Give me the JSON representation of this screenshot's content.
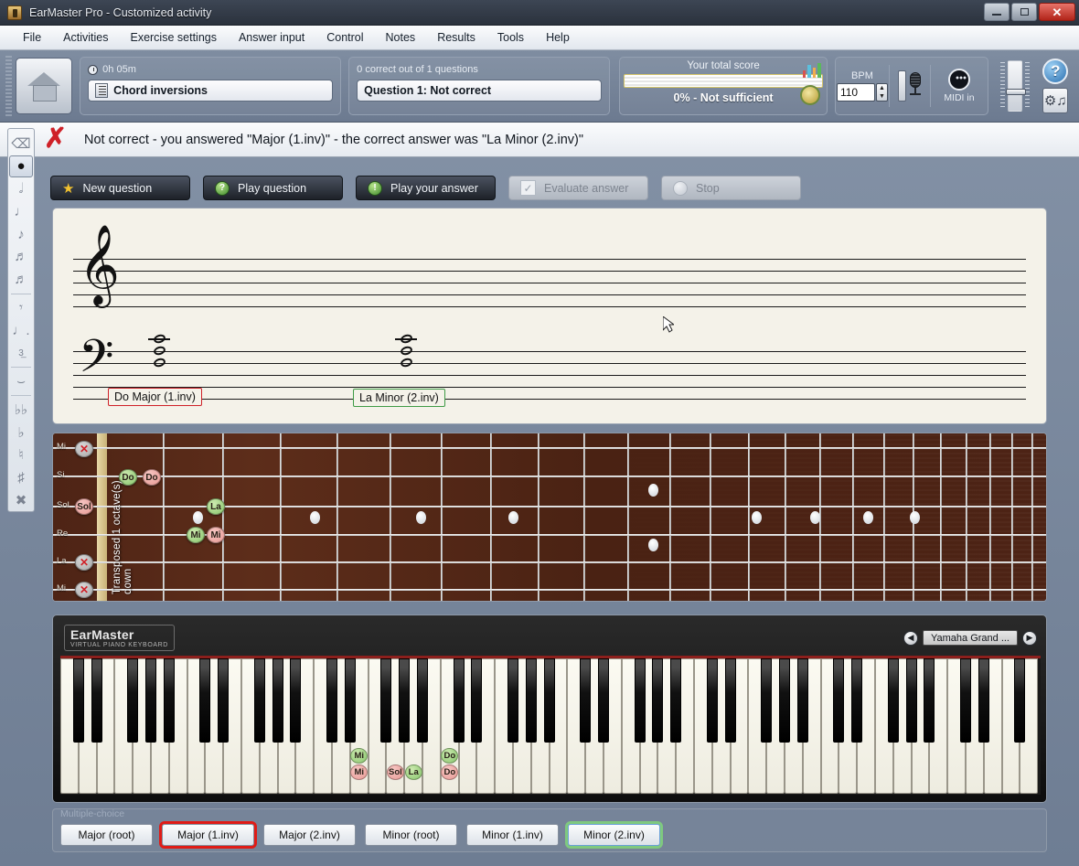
{
  "window": {
    "title": "EarMaster Pro - Customized activity",
    "app_icon": "earmaster-icon",
    "minimize": "–",
    "maximize": "❐",
    "close": "✕"
  },
  "menu": {
    "items": [
      "File",
      "Activities",
      "Exercise settings",
      "Answer input",
      "Control",
      "Notes",
      "Results",
      "Tools",
      "Help"
    ]
  },
  "toolbar": {
    "home_icon": "home-icon",
    "time_label": "0h 05m",
    "activity_name": "Chord inversions",
    "progress_label": "0 correct out of 1 questions",
    "question_status": "Question 1: Not correct",
    "score_title": "Your total score",
    "score_value": "0% - Not sufficient",
    "score_percent": 0,
    "bpm_label": "BPM",
    "bpm_value": "110",
    "midi_label": "MIDI in",
    "help_glyph": "?",
    "settings_icon": "settings-notes-icon",
    "stats_icon": "statistics-icon",
    "medal_icon": "medal-icon"
  },
  "message": {
    "icon": "error-x-icon",
    "text": "Not correct - you answered \"Major (1.inv)\" - the correct answer was \"La Minor (2.inv)\""
  },
  "left_toolbar": {
    "items": [
      {
        "name": "eraser-icon",
        "glyph": "⌫"
      },
      {
        "name": "whole-note-icon",
        "glyph": "𝄽",
        "selected": true
      },
      {
        "name": "half-note-icon",
        "glyph": "𝅗𝅥"
      },
      {
        "name": "quarter-note-icon",
        "glyph": "♩"
      },
      {
        "name": "eighth-note-icon",
        "glyph": "♪"
      },
      {
        "name": "sixteenth-note-icon",
        "glyph": "♫"
      },
      {
        "name": "thirtysecond-note-icon",
        "glyph": "♬"
      },
      {
        "name": "rest-icon",
        "glyph": "𝄽"
      },
      {
        "name": "dotted-note-icon",
        "glyph": "♩."
      },
      {
        "name": "triplet-icon",
        "glyph": "3"
      },
      {
        "name": "tie-icon",
        "glyph": "⌣"
      },
      {
        "name": "double-flat-icon",
        "glyph": "𝄫"
      },
      {
        "name": "flat-icon",
        "glyph": "♭"
      },
      {
        "name": "natural-icon",
        "glyph": "♮"
      },
      {
        "name": "sharp-icon",
        "glyph": "♯"
      },
      {
        "name": "double-sharp-icon",
        "glyph": "𝄪"
      }
    ]
  },
  "actions": [
    {
      "name": "new-question-button",
      "label": "New question",
      "icon": "star-icon",
      "state": "enabled"
    },
    {
      "name": "play-question-button",
      "label": "Play question",
      "icon": "play-question-icon",
      "state": "enabled"
    },
    {
      "name": "play-your-answer-button",
      "label": "Play your answer",
      "icon": "play-answer-icon",
      "state": "enabled"
    },
    {
      "name": "evaluate-answer-button",
      "label": "Evaluate answer",
      "icon": "check-icon",
      "state": "disabled"
    },
    {
      "name": "stop-button",
      "label": "Stop",
      "icon": "stop-icon",
      "state": "disabled"
    }
  ],
  "staff": {
    "treble_clef": "𝄞",
    "bass_clef": "𝄢",
    "chords": [
      {
        "label": "Do Major (1.inv)",
        "status": "wrong"
      },
      {
        "label": "La Minor (2.inv)",
        "status": "correct"
      }
    ]
  },
  "fretboard": {
    "transposed_note": "Transposed 1 octave(s) down",
    "string_labels": [
      "Mi",
      "Si",
      "Sol",
      "Re",
      "La",
      "Mi"
    ],
    "markers": [
      {
        "string": "Mi",
        "label": "✕",
        "color": "grey"
      },
      {
        "string": "Si",
        "label": "Do",
        "color": "green"
      },
      {
        "string": "Si",
        "label": "Do",
        "color": "red"
      },
      {
        "string": "Sol",
        "label": "Sol",
        "color": "red"
      },
      {
        "string": "Sol",
        "label": "La",
        "color": "green"
      },
      {
        "string": "Re",
        "label": "Mi",
        "color": "green"
      },
      {
        "string": "Re",
        "label": "Mi",
        "color": "red"
      },
      {
        "string": "La",
        "label": "✕",
        "color": "grey"
      },
      {
        "string": "Mi",
        "label": "✕",
        "color": "grey"
      }
    ]
  },
  "piano": {
    "logo_title": "EarMaster",
    "logo_subtitle": "VIRTUAL PIANO KEYBOARD",
    "instrument": "Yamaha Grand ...",
    "prev_glyph": "◀",
    "next_glyph": "▶",
    "markers": [
      {
        "label": "Mi",
        "color": "green"
      },
      {
        "label": "Mi",
        "color": "red"
      },
      {
        "label": "Sol",
        "color": "red"
      },
      {
        "label": "La",
        "color": "green"
      },
      {
        "label": "Do",
        "color": "green"
      },
      {
        "label": "Do",
        "color": "red"
      }
    ]
  },
  "multiple_choice": {
    "legend": "Multiple-choice",
    "options": [
      {
        "label": "Major (root)",
        "state": "normal"
      },
      {
        "label": "Major (1.inv)",
        "state": "wrong"
      },
      {
        "label": "Major (2.inv)",
        "state": "normal"
      },
      {
        "label": "Minor (root)",
        "state": "normal"
      },
      {
        "label": "Minor (1.inv)",
        "state": "normal"
      },
      {
        "label": "Minor (2.inv)",
        "state": "correct"
      }
    ]
  },
  "colors": {
    "wrong": "#e01b16",
    "correct": "#7fc97f",
    "accent": "#2a6fb0",
    "chrome": "#6e7d93"
  }
}
